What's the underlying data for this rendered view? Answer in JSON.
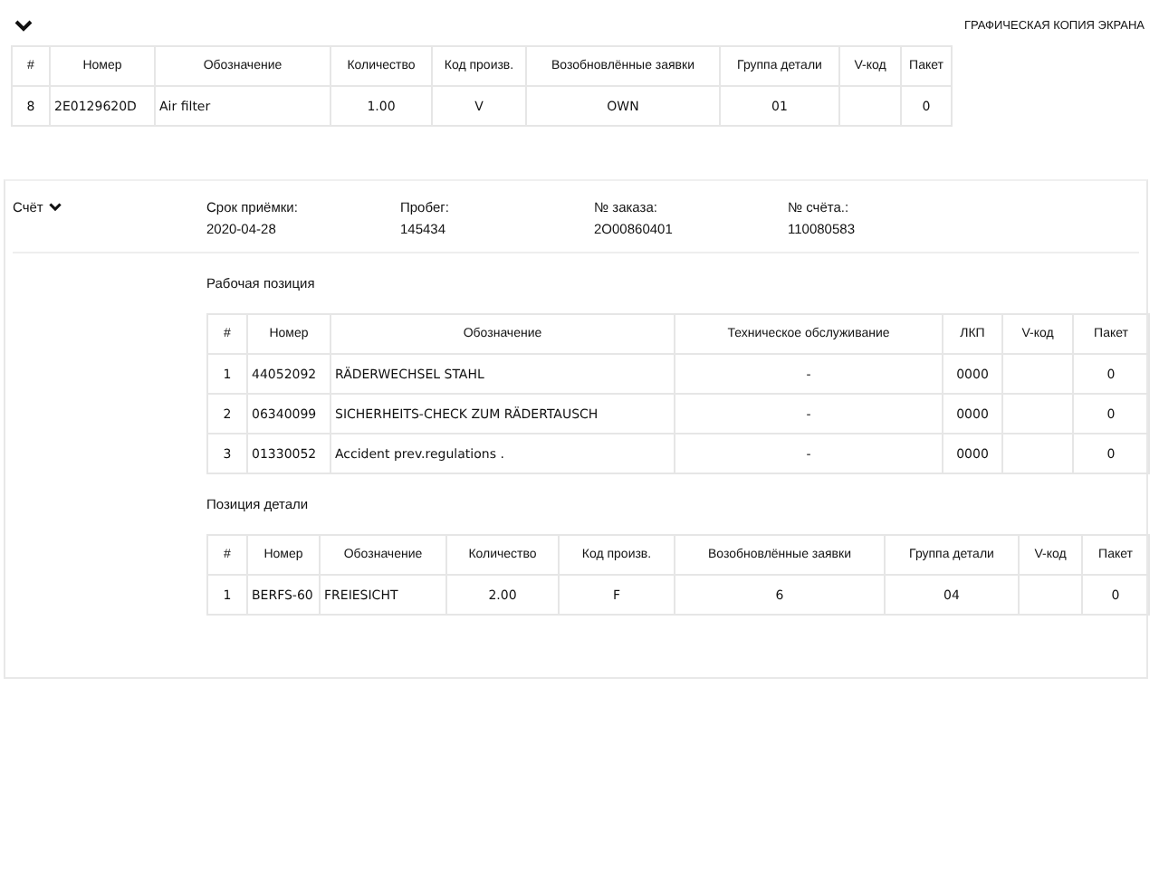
{
  "top": {
    "caption": "ГРАФИЧЕСКАЯ КОПИЯ ЭКРАНА"
  },
  "parts_table": {
    "columns": [
      "#",
      "Номер",
      "Обозначение",
      "Количество",
      "Код произв.",
      "Возобновлённые заявки",
      "Группа детали",
      "V-код",
      "Пакет"
    ],
    "rows": [
      [
        "8",
        "2E0129620D",
        "Air filter",
        "1.00",
        "V",
        "OWN",
        "01",
        "",
        "0"
      ]
    ]
  },
  "invoice": {
    "label": "Счёт",
    "fields": [
      {
        "label": "Срок приёмки:",
        "value": "2020-04-28"
      },
      {
        "label": "Пробег:",
        "value": "145434"
      },
      {
        "label": "№ заказа:",
        "value": "2O00860401"
      },
      {
        "label": "№ счёта.:",
        "value": "110080583"
      }
    ],
    "sections": [
      {
        "title": "Рабочая позиция",
        "columns": [
          "#",
          "Номер",
          "Обозначение",
          "Техническое обслуживание",
          "ЛКП",
          "V-код",
          "Пакет"
        ],
        "rows": [
          [
            "1",
            "44052092",
            "RÄDERWECHSEL STAHL",
            "-",
            "0000",
            "",
            "0"
          ],
          [
            "2",
            "06340099",
            "SICHERHEITS-CHECK ZUM RÄDERTAUSCH",
            "-",
            "0000",
            "",
            "0"
          ],
          [
            "3",
            "01330052",
            "Accident prev.regulations .",
            "-",
            "0000",
            "",
            "0"
          ]
        ]
      },
      {
        "title": "Позиция детали",
        "columns": [
          "#",
          "Номер",
          "Обозначение",
          "Количество",
          "Код произв.",
          "Возобновлённые заявки",
          "Группа детали",
          "V-код",
          "Пакет"
        ],
        "rows": [
          [
            "1",
            "BERFS-60",
            "FREIESICHT",
            "2.00",
            "F",
            "6",
            "04",
            "",
            "0"
          ]
        ]
      }
    ]
  }
}
